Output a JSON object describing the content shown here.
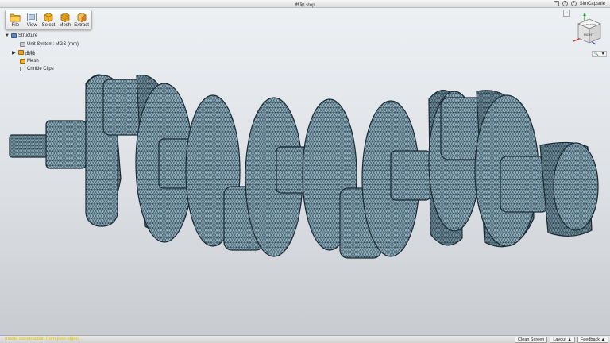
{
  "window": {
    "title": "曲轴.step",
    "user_name": "SimCapsule",
    "help_symbol": "?"
  },
  "toolbar": {
    "buttons": [
      {
        "label": "File",
        "icon": "folder-icon"
      },
      {
        "label": "View",
        "icon": "view-icon"
      },
      {
        "label": "Select",
        "icon": "select-cube-icon"
      },
      {
        "label": "Mesh",
        "icon": "mesh-cube-icon"
      },
      {
        "label": "Extract",
        "icon": "extract-cube-icon"
      }
    ]
  },
  "tree": {
    "root": {
      "label": "Structure",
      "expanded": true
    },
    "items": [
      {
        "label": "Unit System: MGS (mm)",
        "icon": "units-icon"
      },
      {
        "label": "曲轴",
        "icon": "part-icon",
        "collapsed": true
      },
      {
        "label": "Mesh",
        "icon": "mesh-icon"
      },
      {
        "label": "Crinkle Clips",
        "icon": "clips-icon"
      }
    ]
  },
  "viewcube": {
    "face_label": "RIGHT",
    "top_label": "BOTTOM"
  },
  "statusbar": {
    "message": "model construction from json object",
    "buttons": {
      "clean_screen": "Clean Screen",
      "layout": "Layout ▲",
      "feedback": "Feedback ▲"
    }
  },
  "colors": {
    "mesh_face": "#8fb0c0",
    "mesh_face_dark": "#6f8e9d",
    "mesh_edge": "#1a2a33",
    "status_text": "#e0c400",
    "axis_x": "#d03030",
    "axis_y": "#30a030",
    "axis_z": "#3050d0"
  }
}
